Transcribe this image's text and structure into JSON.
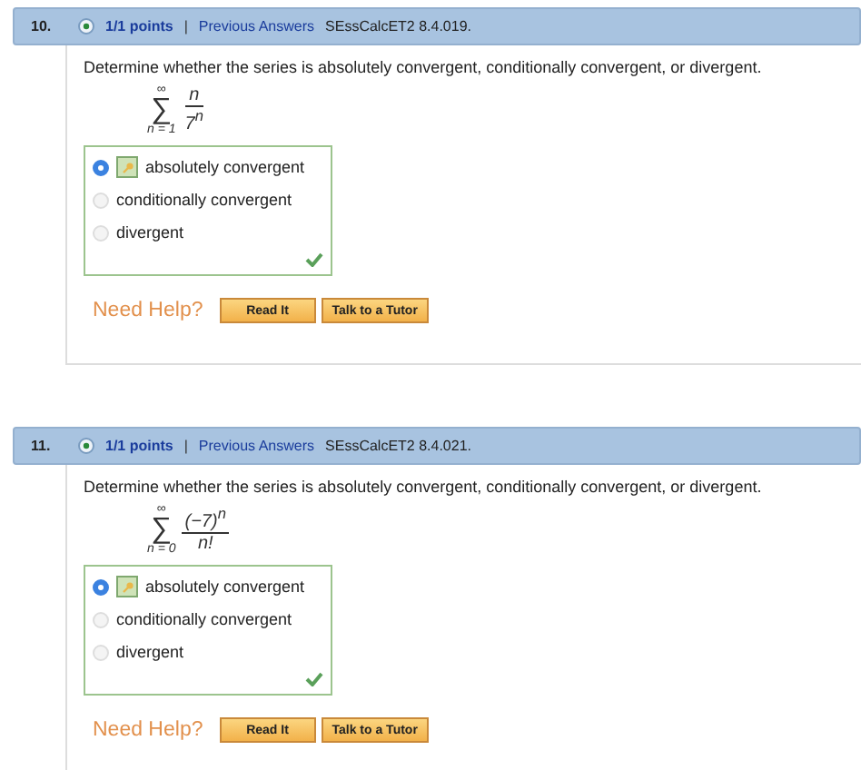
{
  "questions": [
    {
      "number": "10.",
      "points": "1/1 points",
      "separator": "|",
      "history_link": "Previous Answers",
      "code": "SEssCalcET2 8.4.019.",
      "prompt": "Determine whether the series is absolutely convergent, conditionally convergent, or divergent.",
      "series": {
        "symbol": "∑",
        "upper": "∞",
        "lower": "n = 1",
        "numerator": "n",
        "denominator": "7$^{n}$"
      },
      "options": [
        {
          "label": "absolutely convergent",
          "selected": true
        },
        {
          "label": "conditionally convergent",
          "selected": false
        },
        {
          "label": "divergent",
          "selected": false
        }
      ],
      "correct": true,
      "help_label": "Need Help?",
      "buttons": [
        "Read It",
        "Talk to a Tutor"
      ]
    },
    {
      "number": "11.",
      "points": "1/1 points",
      "separator": "|",
      "history_link": "Previous Answers",
      "code": "SEssCalcET2 8.4.021.",
      "prompt": "Determine whether the series is absolutely convergent, conditionally convergent, or divergent.",
      "series": {
        "symbol": "∑",
        "upper": "∞",
        "lower": "n = 0",
        "numerator": "(−7)$^{n}$",
        "denominator": "n!"
      },
      "options": [
        {
          "label": "absolutely convergent",
          "selected": true
        },
        {
          "label": "conditionally convergent",
          "selected": false
        },
        {
          "label": "divergent",
          "selected": false
        }
      ],
      "correct": true,
      "help_label": "Need Help?",
      "buttons": [
        "Read It",
        "Talk to a Tutor"
      ]
    }
  ]
}
